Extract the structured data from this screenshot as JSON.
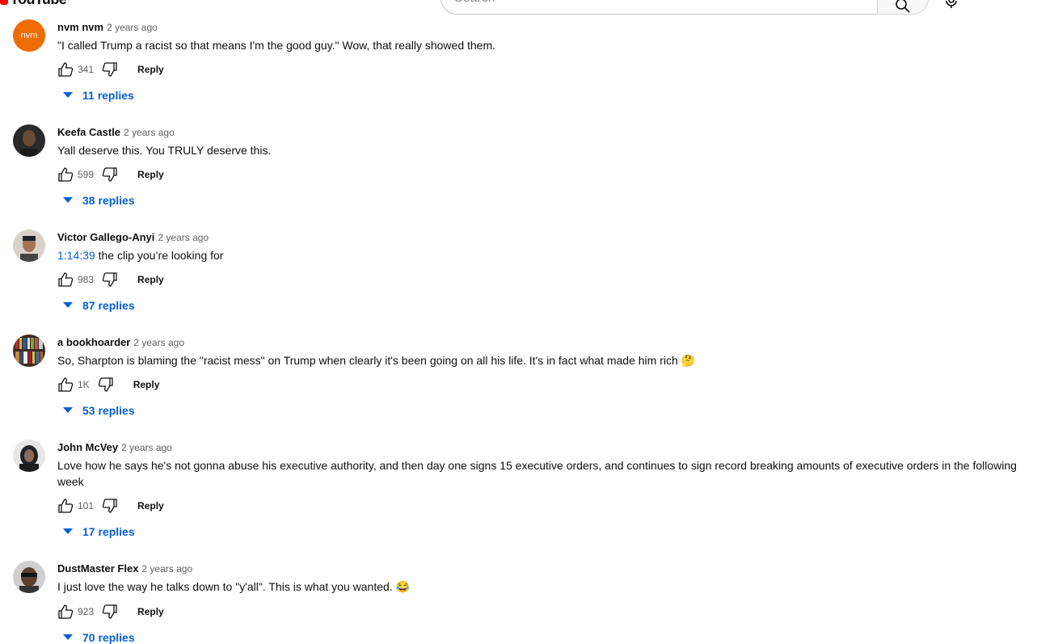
{
  "header": {
    "logo_text": "YouTube",
    "search_placeholder": "Search"
  },
  "colors": {
    "link": "#065fd4",
    "brand": "#ff0000"
  },
  "comments": [
    {
      "author": "nvm nvm",
      "time": "2 years ago",
      "avatar": "nvm",
      "text": "\"I called Trump a racist so that means I'm the good guy.\" Wow, that really showed them.",
      "likes": "341",
      "reply_label": "Reply",
      "replies": "11 replies"
    },
    {
      "author": "Keefa Castle",
      "time": "2 years ago",
      "text": "Yall deserve this. You TRULY deserve this.",
      "likes": "599",
      "reply_label": "Reply",
      "replies": "38 replies"
    },
    {
      "author": "Victor Gallego-Anyi",
      "time": "2 years ago",
      "timestamp": "1:14:39",
      "text": " the clip you’re looking for",
      "likes": "983",
      "reply_label": "Reply",
      "replies": "87 replies"
    },
    {
      "author": "a bookhoarder",
      "time": "2 years ago",
      "text": "So, Sharpton is blaming the \"racist mess\" on Trump when clearly it's been going on all his life.  It's in fact what made him rich 🤔",
      "likes": "1K",
      "reply_label": "Reply",
      "replies": "53 replies"
    },
    {
      "author": "John McVey",
      "time": "2 years ago",
      "text": "Love how he says he's not gonna abuse his executive authority, and then day one signs 15 executive orders, and continues to sign record breaking amounts of executive orders in the following week",
      "likes": "101",
      "reply_label": "Reply",
      "replies": "17 replies"
    },
    {
      "author": "DustMaster Flex",
      "time": "2 years ago",
      "text": "I just love the way he talks down to \"y'all\". This is what you wanted. 😂",
      "likes": "923",
      "reply_label": "Reply",
      "replies": "70 replies"
    }
  ]
}
